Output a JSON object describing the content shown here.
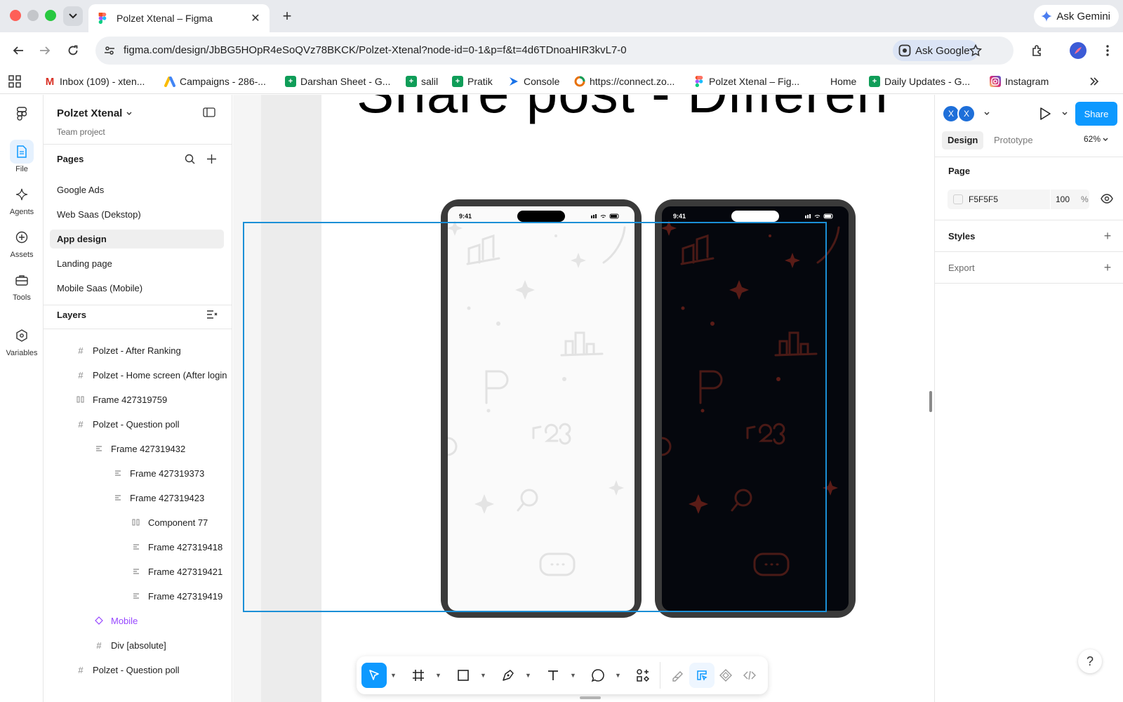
{
  "browser": {
    "tab_title": "Polzet Xtenal – Figma",
    "new_tab_icon": "plus-icon",
    "gemini_label": "Ask Gemini",
    "url": "figma.com/design/JbBG5HOpR4eSoQVz78BKCK/Polzet-Xtenal?node-id=0-1&p=f&t=4d6TDnoaHIR3kvL7-0",
    "ask_google_label": "Ask Google",
    "bookmarks": [
      {
        "label": "Inbox (109) - xten...",
        "icon": "gmail-icon",
        "color": "#d93025"
      },
      {
        "label": "Campaigns - 286-...",
        "icon": "google-ads-icon",
        "color": "#4285f4"
      },
      {
        "label": "Darshan Sheet - G...",
        "icon": "sheets-icon",
        "color": "#0f9d58"
      },
      {
        "label": "salil",
        "icon": "sheets-icon",
        "color": "#0f9d58"
      },
      {
        "label": "Pratik",
        "icon": "sheets-icon",
        "color": "#0f9d58"
      },
      {
        "label": "Console",
        "icon": "console-icon",
        "color": "#1a73e8"
      },
      {
        "label": "https://connect.zo...",
        "icon": "zoho-icon",
        "color": "#e8710a"
      },
      {
        "label": "Polzet Xtenal – Fig...",
        "icon": "figma-icon",
        "color": "#f24e1e"
      },
      {
        "label": "Home",
        "icon": "",
        "color": ""
      },
      {
        "label": "Daily Updates - G...",
        "icon": "sheets-icon",
        "color": "#0f9d58"
      },
      {
        "label": "Instagram",
        "icon": "instagram-icon",
        "color": "#d62976"
      }
    ]
  },
  "rail": {
    "items": [
      {
        "label": "File",
        "icon": "file-icon"
      },
      {
        "label": "Agents",
        "icon": "sparkle-icon"
      },
      {
        "label": "Assets",
        "icon": "assets-icon"
      },
      {
        "label": "Tools",
        "icon": "toolbox-icon"
      },
      {
        "label": "Variables",
        "icon": "variables-icon"
      }
    ]
  },
  "left_panel": {
    "project_name": "Polzet Xtenal",
    "project_sub": "Team project",
    "pages_header": "Pages",
    "pages": [
      {
        "label": "Google Ads",
        "active": false
      },
      {
        "label": "Web Saas (Dekstop)",
        "active": false
      },
      {
        "label": "App design",
        "active": true
      },
      {
        "label": "Landing page",
        "active": false
      },
      {
        "label": "Mobile Saas (Mobile)",
        "active": false
      }
    ],
    "layers_header": "Layers",
    "layers": [
      {
        "label": "Polzet - After Ranking",
        "icon": "frame-icon"
      },
      {
        "label": "Polzet - Home screen (After login",
        "icon": "frame-icon"
      },
      {
        "label": "Frame 427319759",
        "icon": "auto-layout-horizontal-icon"
      },
      {
        "label": "Polzet - Question poll",
        "icon": "frame-icon"
      },
      {
        "label": "Frame 427319432",
        "icon": "auto-layout-vertical-icon"
      },
      {
        "label": "Frame 427319373",
        "icon": "auto-layout-vertical-icon"
      },
      {
        "label": "Frame 427319423",
        "icon": "auto-layout-vertical-icon"
      },
      {
        "label": "Component 77",
        "icon": "auto-layout-horizontal-icon"
      },
      {
        "label": "Frame 427319418",
        "icon": "auto-layout-vertical-icon"
      },
      {
        "label": "Frame 427319421",
        "icon": "auto-layout-vertical-icon"
      },
      {
        "label": "Frame 427319419",
        "icon": "auto-layout-vertical-icon"
      },
      {
        "label": "Mobile",
        "icon": "component-instance-icon"
      },
      {
        "label": "Div [absolute]",
        "icon": "frame-icon"
      },
      {
        "label": "Polzet - Question poll",
        "icon": "frame-icon"
      }
    ]
  },
  "canvas": {
    "heading_text": "Share post - Differen",
    "phone_time": "9:41",
    "light_bg": "#fafafa",
    "dark_bg": "#05070d",
    "selection_color": "#1b8fd6"
  },
  "right_panel": {
    "avatars": [
      "X",
      "X"
    ],
    "share_label": "Share",
    "tabs": [
      "Design",
      "Prototype"
    ],
    "zoom": "62%",
    "page_header": "Page",
    "fill_hex": "F5F5F5",
    "fill_opacity": "100",
    "fill_unit": "%",
    "styles_header": "Styles",
    "export_header": "Export",
    "help_label": "?"
  },
  "toolbar_tools": [
    "move-icon",
    "frame-icon",
    "rectangle-icon",
    "pen-icon",
    "text-icon",
    "comment-icon",
    "actions-icon",
    "draw-icon",
    "design-mode-icon",
    "dev-component-icon",
    "code-icon"
  ]
}
